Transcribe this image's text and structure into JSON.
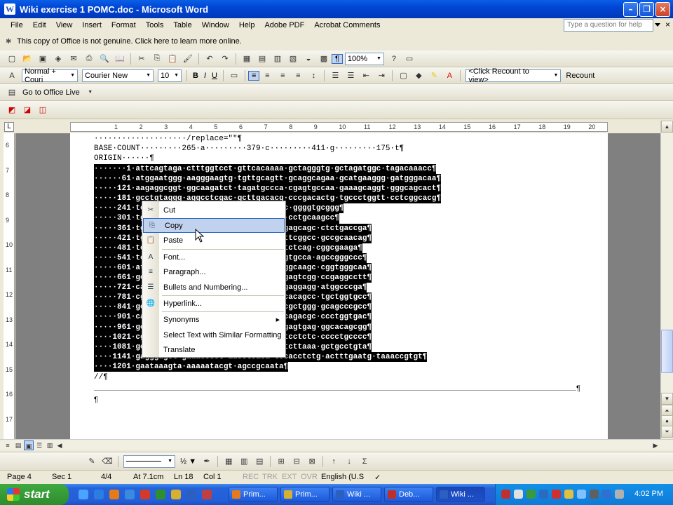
{
  "window": {
    "title": "Wiki exercise 1 POMC.doc - Microsoft Word",
    "app_glyph": "W"
  },
  "menubar": {
    "items": [
      "File",
      "Edit",
      "View",
      "Insert",
      "Format",
      "Tools",
      "Table",
      "Window",
      "Help",
      "Adobe PDF",
      "Acrobat Comments"
    ],
    "help_placeholder": "Type a question for help",
    "close_glyph": "×"
  },
  "notice": "This copy of Office is not genuine.  Click here to learn more online.",
  "toolbar_standard": {
    "zoom": "100%"
  },
  "toolbar_format": {
    "style": "Normal + Couri",
    "font": "Courier New",
    "size": "10",
    "bold": "B",
    "italic": "I",
    "underline": "U",
    "recount_placeholder": "<Click Recount to view>",
    "recount_button": "Recount"
  },
  "toolbar_office_live": {
    "label": "Go to Office Live"
  },
  "ruler": {
    "labels": [
      "1",
      "2",
      "3",
      "4",
      "5",
      "6",
      "7",
      "8",
      "9",
      "10",
      "11",
      "12",
      "13",
      "14",
      "15",
      "16",
      "17",
      "18",
      "19",
      "20"
    ]
  },
  "vruler": {
    "labels": [
      "6",
      "7",
      "8",
      "9",
      "10",
      "11",
      "12",
      "13",
      "14",
      "15",
      "16",
      "17"
    ]
  },
  "document": {
    "line_replace": "····················/replace=\"\"¶",
    "line_basecount": "BASE·COUNT·········265·a·········379·c·········411·g·········175·t¶",
    "line_origin": "ORIGIN······¶",
    "sequence": [
      "·······1·attcagtaga·ctttggtcct·gttcacaaaa·gctagggtg·gctagatggc·tagacaaacc¶",
      "······61·atggaatggg·aagggaagtg·tgttgcagtt·gcaggcagaa·gcatgaaggg·gatgggacaa¶",
      "·····121·aagaggcggt·ggcaagatct·tagatgccca·cgagtgccaa·gaaagcaggt·gggcagcact¶",
      "·····181·gcctgtaggg·aggcctcgac·gcttgacacg·cccgacactg·tgccctggtt·cctcggcacg¶",
      "·····241·tccgcagcagtg·acggcgcgg·cagccggccc·ggggtgcggg¶",
      "·····301·tgccagaacc·ccccaggagg·tgcatccggg·cctgcaagcc¶",
      "·····361·tgccagcccg·gttccc·gggaaatggc·gacgagcagc·ctctgaccga¶",
      "·····421·tgccatcggc·ccactt·ccgctggcac·cgattcggcc·gccgcaacag¶",
      "·····481·tcggcttcgg·gggca·gaagcgcgag·gacgtctcag·cggcgaaga¶",
      "·····541·tccgcctgcc·cccga·gcccgcagac·gatggtgcca·agccgggccc¶",
      "·····601·atgcgcgagg·catgga·gcacttccgc·tggggcaagc·cggtgggcaa¶",
      "·····661·gcgccgcccg·ccctaa·cggcgccgag·gacgagtcgg·ccgaggcctt¶",
      "·····721·cagcgccggc·gactgg·ccagcgactc·cgggaggagg·atggcccga¶",
      "·····781·cggaccccag·gcccca·ggccgacctg·gagcacagcc·tgctggtgcc¶",
      "·····841·gcagtggtca·ctacag·gatggagcac·ttccgctggg·gcagcccgcc¶",
      "·····901·cagtgccggc·catgac·ctccgagaag·agccagacgc·ccctggtgac¶",
      "·····961·gcgctcgtcc·aacgcg·ctacaagaag·ggcgagtgag·ggcacagcgg¶",
      "····1021·cgagggcgcg·agtcgg·acccaaaggc·ccctcctctc·cccctgcccc¶",
      "····1081·gctcacgtcg·cctggg·cagataatca·gcctcttaaa·gctgcctgta¶",
      "····1141·gagggagct·gaaacccct·aacctcaca·tccacctctg·actttgaatg·taaaccgtgt¶",
      "····1201·gaataaagta·aaaaatacgt·agccgcaata¶"
    ],
    "line_end": "//¶",
    "para_mark": "¶"
  },
  "context_menu": {
    "items": [
      {
        "label": "Cut",
        "icon": "cut-icon"
      },
      {
        "label": "Copy",
        "icon": "copy-icon"
      },
      {
        "label": "Paste",
        "icon": "paste-icon"
      },
      {
        "label": "Font...",
        "icon": "font-icon"
      },
      {
        "label": "Paragraph...",
        "icon": "paragraph-icon"
      },
      {
        "label": "Bullets and Numbering...",
        "icon": "bullets-icon"
      },
      {
        "label": "Hyperlink...",
        "icon": "hyperlink-icon"
      },
      {
        "label": "Synonyms",
        "icon": ""
      },
      {
        "label": "Select Text with Similar Formatting",
        "icon": ""
      },
      {
        "label": "Translate",
        "icon": ""
      }
    ],
    "highlighted": "Copy"
  },
  "drawbar": {
    "line_weight": "½"
  },
  "statusbar": {
    "page": "Page  4",
    "sec": "Sec  1",
    "pages": "4/4",
    "at": "At  7.1cm",
    "ln": "Ln  18",
    "col": "Col  1",
    "rec": "REC",
    "trk": "TRK",
    "ext": "EXT",
    "ovr": "OVR",
    "lang": "English (U.S"
  },
  "taskbar": {
    "start": "start",
    "buttons": [
      "Prim...",
      "Prim...",
      "Wiki ...",
      "Deb...",
      "Wiki ..."
    ],
    "clock": "4:02 PM"
  },
  "colors": {
    "titlebar": "#0046d5",
    "selection_bg": "#000000",
    "menu_highlight": "#c1d2ee",
    "taskbar": "#245ed8"
  }
}
